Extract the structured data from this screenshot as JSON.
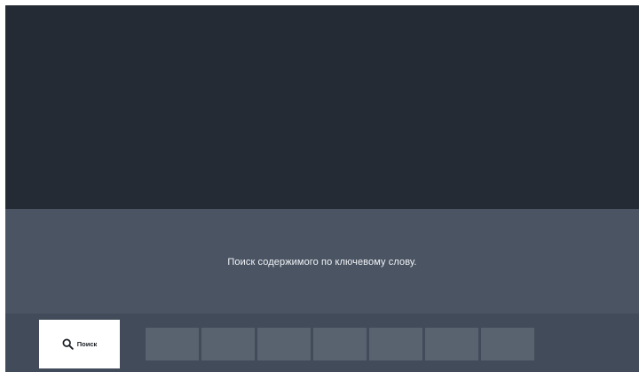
{
  "message": {
    "text": "Поиск содержимого по ключевому слову."
  },
  "toolbar": {
    "search_button": {
      "label": "Поиск",
      "icon": "search-icon"
    },
    "keys_count_visible": 7
  },
  "colors": {
    "background_dark": "#252b35",
    "message_panel": "#4a5463",
    "bottom_bar": "#424b59",
    "key": "#59626f",
    "search_button_bg": "#ffffff",
    "text_light": "#f2f4f7"
  }
}
